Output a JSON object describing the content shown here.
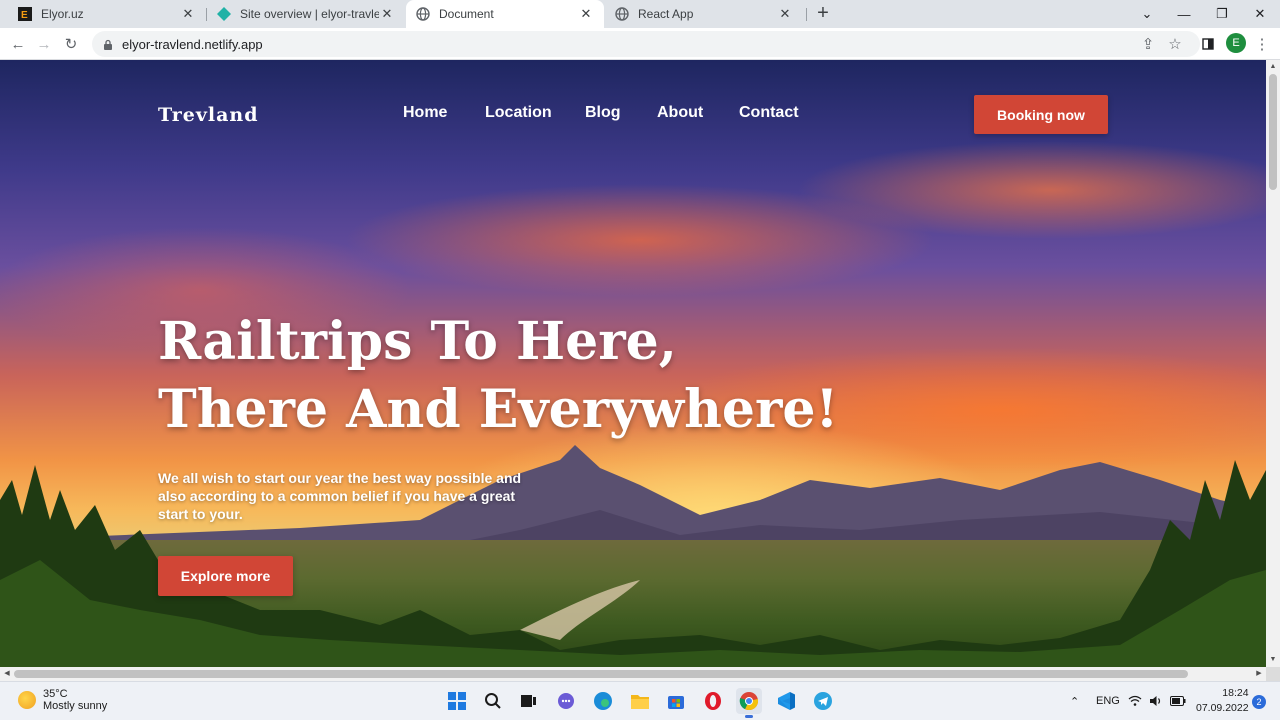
{
  "browser": {
    "tabs": [
      {
        "title": "Elyor.uz",
        "icon": "e-letter-icon"
      },
      {
        "title": "Site overview | elyor-travlend",
        "icon": "netlify-diamond-icon"
      },
      {
        "title": "Document",
        "icon": "globe-icon"
      },
      {
        "title": "React App",
        "icon": "globe-icon"
      }
    ],
    "active_tab_index": 2,
    "new_tab_symbol": "+",
    "address": "elyor-travlend.netlify.app",
    "profile_initial": "E"
  },
  "site": {
    "logo": "Trevland",
    "nav": [
      "Home",
      "Location",
      "Blog",
      "About",
      "Contact"
    ],
    "cta": "Booking now",
    "headline_line1": "Railtrips To Here,",
    "headline_line2": "There And Everywhere!",
    "subtext": "We all wish to start our year the best way possible and also according to a common belief if you have a great start to your.",
    "explore": "Explore more",
    "accent_color": "#d14636"
  },
  "taskbar": {
    "weather_temp": "35°C",
    "weather_desc": "Mostly sunny",
    "language": "ENG",
    "time": "18:24",
    "date": "07.09.2022",
    "notification_count": "2",
    "apps": [
      "start",
      "search",
      "task-view",
      "chat",
      "edge",
      "file-explorer",
      "store",
      "opera",
      "chrome",
      "vscode",
      "telegram"
    ]
  }
}
